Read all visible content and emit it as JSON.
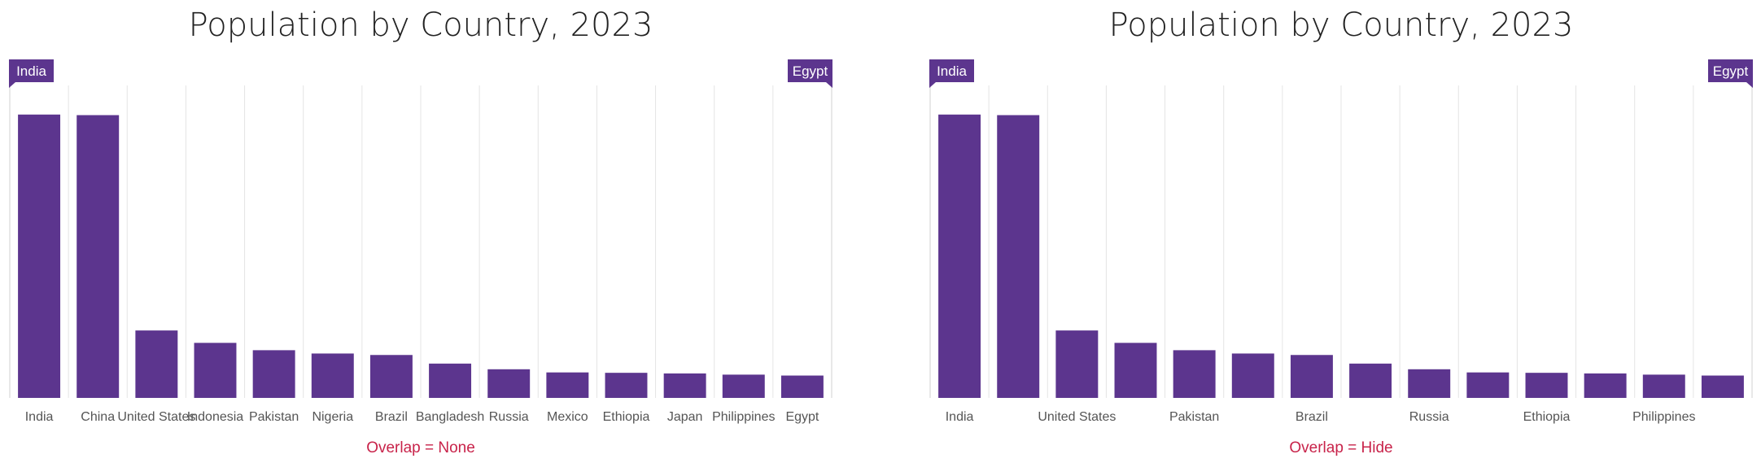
{
  "chart_data": [
    {
      "type": "bar",
      "title": "Population by Country, 2023",
      "caption": "Overlap = None",
      "categories": [
        "India",
        "China",
        "United States",
        "Indonesia",
        "Pakistan",
        "Nigeria",
        "Brazil",
        "Bangladesh",
        "Russia",
        "Mexico",
        "Ethiopia",
        "Japan",
        "Philippines",
        "Egypt"
      ],
      "visible_labels": [
        "India",
        "China",
        "United States",
        "Indonesia",
        "Pakistan",
        "Nigeria",
        "Brazil",
        "Bangladesh",
        "Russia",
        "Mexico",
        "Ethiopia",
        "Japan",
        "Philippines",
        "Egypt"
      ],
      "values": [
        1428.6,
        1425.7,
        340.0,
        277.5,
        240.5,
        223.8,
        216.4,
        173.0,
        144.4,
        128.5,
        126.5,
        123.3,
        117.3,
        112.7
      ],
      "range_callouts": {
        "start": "India",
        "end": "Egypt"
      },
      "ylim": [
        0,
        1600
      ],
      "grid": "vertical",
      "xlabel": "",
      "ylabel": ""
    },
    {
      "type": "bar",
      "title": "Population by Country, 2023",
      "caption": "Overlap = Hide",
      "categories": [
        "India",
        "China",
        "United States",
        "Indonesia",
        "Pakistan",
        "Nigeria",
        "Brazil",
        "Bangladesh",
        "Russia",
        "Mexico",
        "Ethiopia",
        "Japan",
        "Philippines",
        "Egypt"
      ],
      "visible_labels": [
        "India",
        "",
        "United States",
        "",
        "Pakistan",
        "",
        "Brazil",
        "",
        "Russia",
        "",
        "Ethiopia",
        "",
        "Philippines",
        ""
      ],
      "values": [
        1428.6,
        1425.7,
        340.0,
        277.5,
        240.5,
        223.8,
        216.4,
        173.0,
        144.4,
        128.5,
        126.5,
        123.3,
        117.3,
        112.7
      ],
      "range_callouts": {
        "start": "India",
        "end": "Egypt"
      },
      "ylim": [
        0,
        1600
      ],
      "grid": "vertical",
      "xlabel": "",
      "ylabel": ""
    }
  ],
  "colors": {
    "bar": "#5c358e",
    "grid": "#e4e4e4",
    "caption": "#c8234a",
    "callout": "#5c358e"
  }
}
